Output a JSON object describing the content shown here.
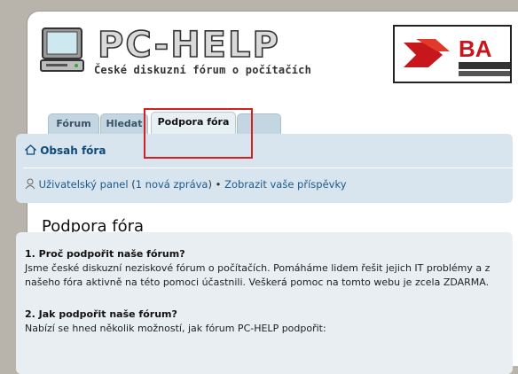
{
  "logo": {
    "title": "PC-HELP",
    "subtitle": "České diskuzní fórum o počítačích"
  },
  "banner": {
    "text": "BA"
  },
  "tabs": [
    {
      "label": "Fórum"
    },
    {
      "label": "Hledat"
    },
    {
      "label": "Podpora fóra"
    },
    {
      "label": ""
    }
  ],
  "nav": {
    "index_link": "Obsah fóra",
    "user_panel": "Uživatelský panel",
    "open_paren": " (",
    "new_messages": "1 nová zpráva",
    "close_paren": ")",
    "bullet": " • ",
    "my_posts": "Zobrazit vaše příspěvky"
  },
  "page": {
    "title": "Podpora fóra",
    "section1_heading": "1. Proč podpořit naše fórum?",
    "section1_line1": "Jsme české diskuzní neziskové fórum o počítačích. Pomáháme lidem řešit jejich IT problémy a z",
    "section1_line2": "našeho fóra aktivně na této pomoci účastnili. Veškerá pomoc na tomto webu je zcela ZDARMA.",
    "section2_heading": "2. Jak podpořit naše fórum?",
    "section2_line1": "Nabízí se hned několik možností, jak fórum PC-HELP podpořit:"
  },
  "colors": {
    "highlight_box": "#d42020",
    "navbar_bg": "#d8e5ee",
    "tab_bg": "#c4d6e2"
  }
}
